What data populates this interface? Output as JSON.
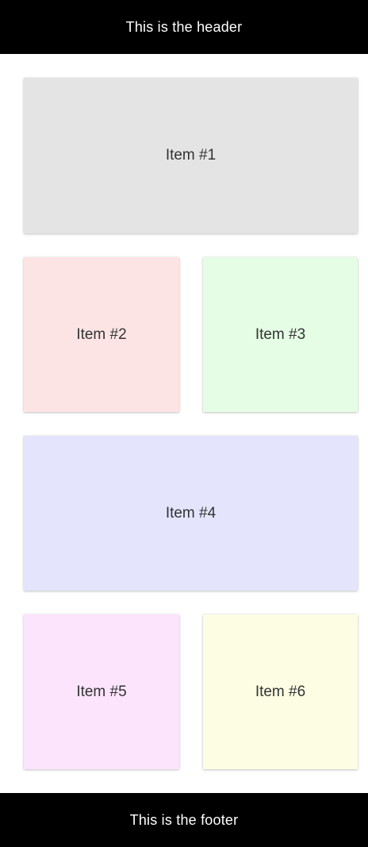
{
  "header": {
    "text": "This is the header",
    "background": "#000000",
    "color": "#ffffff"
  },
  "items": [
    {
      "label": "Item #1",
      "color": "#e4e4e4"
    },
    {
      "label": "Item #2",
      "color": "#fde4e4"
    },
    {
      "label": "Item #3",
      "color": "#e4fde4"
    },
    {
      "label": "Item #4",
      "color": "#e4e4fd"
    },
    {
      "label": "Item #5",
      "color": "#fce4fc"
    },
    {
      "label": "Item #6",
      "color": "#fdfde4"
    }
  ],
  "footer": {
    "text": "This is the footer",
    "background": "#000000",
    "color": "#ffffff"
  }
}
